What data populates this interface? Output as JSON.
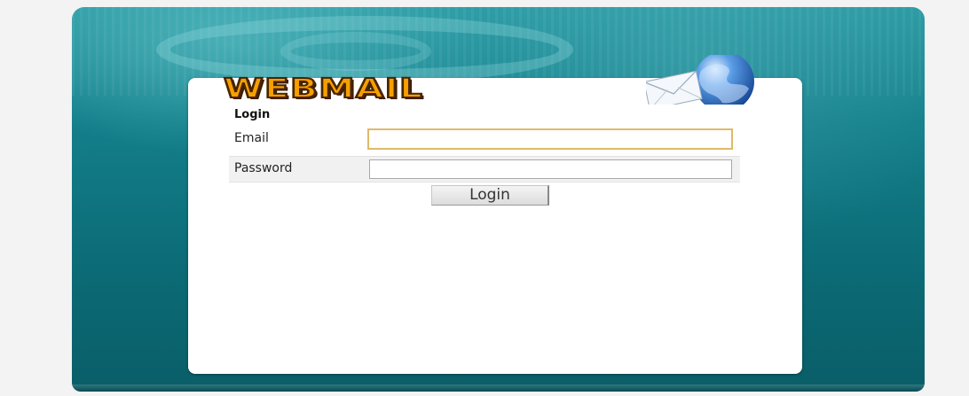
{
  "logo": {
    "text": "WEBMAIL",
    "icon": "globe-envelope-icon",
    "color": "#f5a000"
  },
  "login": {
    "heading": "Login",
    "email_label": "Email",
    "email_value": "",
    "password_label": "Password",
    "password_value": "",
    "button_label": "Login"
  },
  "colors": {
    "background": "#0b6a75",
    "card": "#ffffff",
    "focus_border": "#e0b96a"
  }
}
